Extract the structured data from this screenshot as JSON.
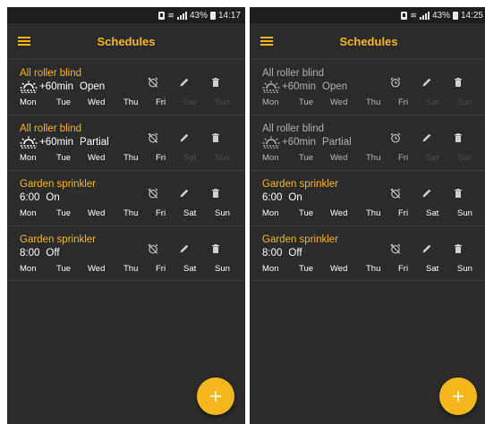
{
  "colors": {
    "accent": "#f5b81c",
    "background": "#2b2b2b",
    "statusbar": "#1e1e1e",
    "text": "#ffffff",
    "muted_text": "#b0b0b0",
    "disabled_day": "#4a4a4a",
    "icon": "#cfcfcf"
  },
  "screens": [
    {
      "status": {
        "battery": "43%",
        "time": "14:17"
      },
      "title": "Schedules",
      "fab_label": "+",
      "items": [
        {
          "title": "All roller blind",
          "title_muted": false,
          "icon": "sunrise-icon",
          "time": "+60min",
          "action": "Open",
          "sub_muted": false,
          "alarm_icon": "alarm-off-icon",
          "days": [
            {
              "label": "Mon",
              "state": "on"
            },
            {
              "label": "Tue",
              "state": "on"
            },
            {
              "label": "Wed",
              "state": "on"
            },
            {
              "label": "Thu",
              "state": "on"
            },
            {
              "label": "Fri",
              "state": "on"
            },
            {
              "label": "Sat",
              "state": "off"
            },
            {
              "label": "Sun",
              "state": "off"
            }
          ]
        },
        {
          "title": "All roller blind",
          "title_muted": false,
          "icon": "sunrise-icon",
          "time": "+60min",
          "action": "Partial",
          "sub_muted": false,
          "alarm_icon": "alarm-off-icon",
          "days": [
            {
              "label": "Mon",
              "state": "on"
            },
            {
              "label": "Tue",
              "state": "on"
            },
            {
              "label": "Wed",
              "state": "on"
            },
            {
              "label": "Thu",
              "state": "on"
            },
            {
              "label": "Fri",
              "state": "on"
            },
            {
              "label": "Sat",
              "state": "off"
            },
            {
              "label": "Sun",
              "state": "off"
            }
          ]
        },
        {
          "title": "Garden sprinkler",
          "title_muted": false,
          "icon": "",
          "time": "6:00",
          "action": "On",
          "sub_muted": false,
          "alarm_icon": "alarm-off-icon",
          "days": [
            {
              "label": "Mon",
              "state": "on"
            },
            {
              "label": "Tue",
              "state": "on"
            },
            {
              "label": "Wed",
              "state": "on"
            },
            {
              "label": "Thu",
              "state": "on"
            },
            {
              "label": "Fri",
              "state": "on"
            },
            {
              "label": "Sat",
              "state": "on"
            },
            {
              "label": "Sun",
              "state": "on"
            }
          ]
        },
        {
          "title": "Garden sprinkler",
          "title_muted": false,
          "icon": "",
          "time": "8:00",
          "action": "Off",
          "sub_muted": false,
          "alarm_icon": "alarm-off-icon",
          "days": [
            {
              "label": "Mon",
              "state": "on"
            },
            {
              "label": "Tue",
              "state": "on"
            },
            {
              "label": "Wed",
              "state": "on"
            },
            {
              "label": "Thu",
              "state": "on"
            },
            {
              "label": "Fri",
              "state": "on"
            },
            {
              "label": "Sat",
              "state": "on"
            },
            {
              "label": "Sun",
              "state": "on"
            }
          ]
        }
      ]
    },
    {
      "status": {
        "battery": "43%",
        "time": "14:25"
      },
      "title": "Schedules",
      "fab_label": "+",
      "items": [
        {
          "title": "All roller blind",
          "title_muted": true,
          "icon": "sunrise-icon",
          "time": "+60min",
          "action": "Open",
          "sub_muted": true,
          "alarm_icon": "alarm-on-icon",
          "days": [
            {
              "label": "Mon",
              "state": "muted"
            },
            {
              "label": "Tue",
              "state": "muted"
            },
            {
              "label": "Wed",
              "state": "muted"
            },
            {
              "label": "Thu",
              "state": "muted"
            },
            {
              "label": "Fri",
              "state": "muted"
            },
            {
              "label": "Sat",
              "state": "off"
            },
            {
              "label": "Sun",
              "state": "off"
            }
          ]
        },
        {
          "title": "All roller blind",
          "title_muted": true,
          "icon": "sunrise-icon",
          "time": "+60min",
          "action": "Partial",
          "sub_muted": true,
          "alarm_icon": "alarm-on-icon",
          "days": [
            {
              "label": "Mon",
              "state": "muted"
            },
            {
              "label": "Tue",
              "state": "muted"
            },
            {
              "label": "Wed",
              "state": "muted"
            },
            {
              "label": "Thu",
              "state": "muted"
            },
            {
              "label": "Fri",
              "state": "muted"
            },
            {
              "label": "Sat",
              "state": "off"
            },
            {
              "label": "Sun",
              "state": "off"
            }
          ]
        },
        {
          "title": "Garden sprinkler",
          "title_muted": false,
          "icon": "",
          "time": "6:00",
          "action": "On",
          "sub_muted": false,
          "alarm_icon": "alarm-off-icon",
          "days": [
            {
              "label": "Mon",
              "state": "on"
            },
            {
              "label": "Tue",
              "state": "on"
            },
            {
              "label": "Wed",
              "state": "on"
            },
            {
              "label": "Thu",
              "state": "on"
            },
            {
              "label": "Fri",
              "state": "on"
            },
            {
              "label": "Sat",
              "state": "on"
            },
            {
              "label": "Sun",
              "state": "on"
            }
          ]
        },
        {
          "title": "Garden sprinkler",
          "title_muted": false,
          "icon": "",
          "time": "8:00",
          "action": "Off",
          "sub_muted": false,
          "alarm_icon": "alarm-off-icon",
          "days": [
            {
              "label": "Mon",
              "state": "on"
            },
            {
              "label": "Tue",
              "state": "on"
            },
            {
              "label": "Wed",
              "state": "on"
            },
            {
              "label": "Thu",
              "state": "on"
            },
            {
              "label": "Fri",
              "state": "on"
            },
            {
              "label": "Sat",
              "state": "on"
            },
            {
              "label": "Sun",
              "state": "on"
            }
          ]
        }
      ]
    }
  ]
}
